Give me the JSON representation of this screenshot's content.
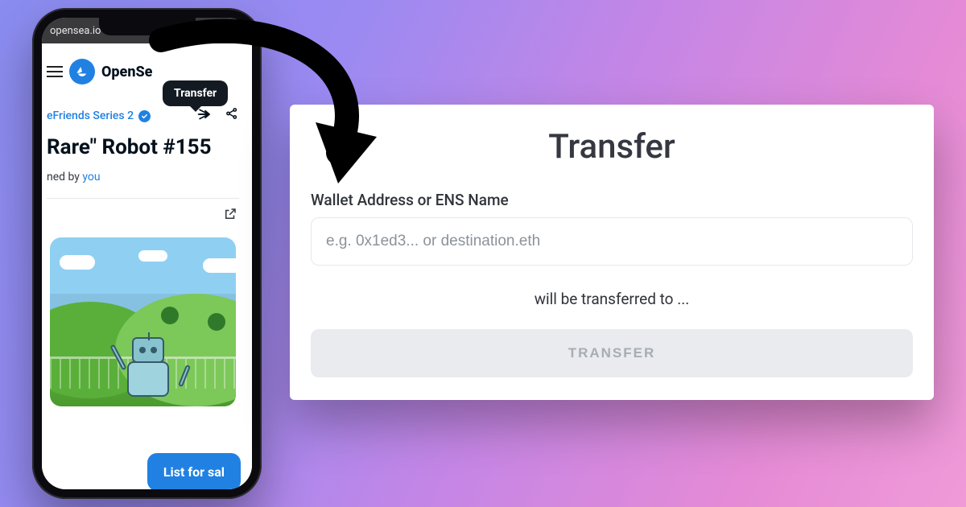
{
  "phone": {
    "url": "opensea.io",
    "brand": "OpenSe",
    "tooltip": "Transfer",
    "collection_name": "eFriends Series 2",
    "nft_title": "Rare\" Robot #155",
    "owned_prefix": "ned by ",
    "owned_link": "you",
    "list_button": "List for sal"
  },
  "modal": {
    "title": "Transfer",
    "field_label": "Wallet Address or ENS Name",
    "placeholder": "e.g. 0x1ed3... or destination.eth",
    "note": "will be transferred to ...",
    "button": "TRANSFER"
  }
}
